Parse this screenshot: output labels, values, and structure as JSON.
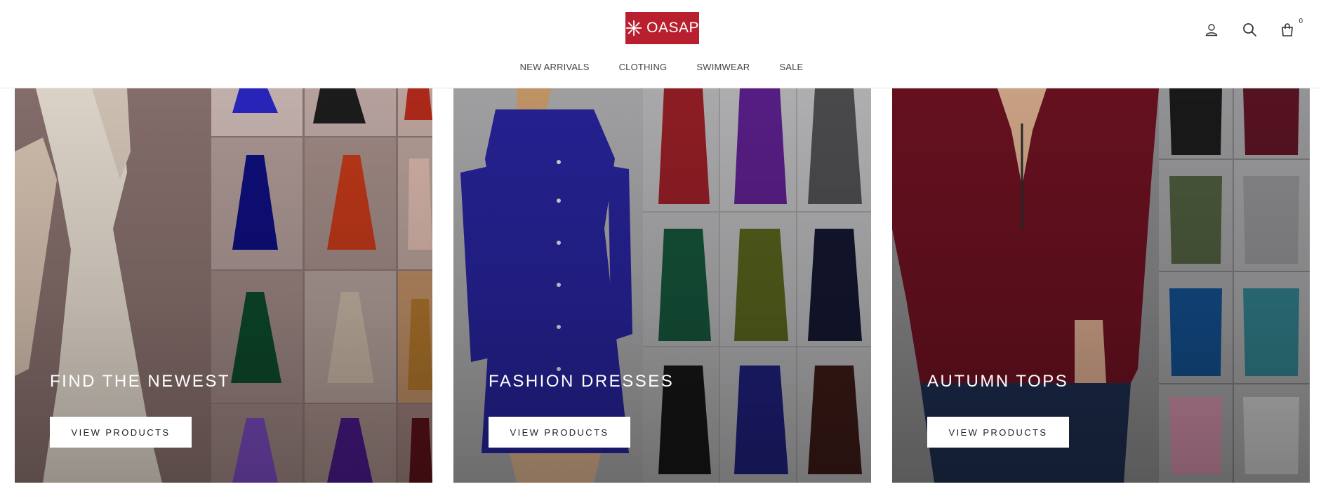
{
  "brand": {
    "logo_text": "OASAP",
    "logo_color": "#b8202f"
  },
  "header": {
    "icons": [
      "account-icon",
      "search-icon",
      "cart-icon"
    ],
    "cart_count": "0"
  },
  "nav": {
    "items": [
      {
        "label": "NEW ARRIVALS"
      },
      {
        "label": "CLOTHING"
      },
      {
        "label": "SWIMWEAR"
      },
      {
        "label": "SALE"
      }
    ]
  },
  "tiles": [
    {
      "title": "FIND THE NEWEST",
      "button": "VIEW PRODUCTS",
      "image_desc": "dress-collage-icon"
    },
    {
      "title": "FASHION DRESSES",
      "button": "VIEW PRODUCTS",
      "image_desc": "dress-grid-icon"
    },
    {
      "title": "AUTUMN TOPS",
      "button": "VIEW PRODUCTS",
      "image_desc": "blouse-grid-icon"
    }
  ],
  "colors": {
    "tile_1_bg": "#8a7471",
    "tile_2_bg": "#9a9a9c",
    "tile_3_bg": "#7b7b7d",
    "burgundy": "#6e1320",
    "royal_blue": "#232388"
  }
}
